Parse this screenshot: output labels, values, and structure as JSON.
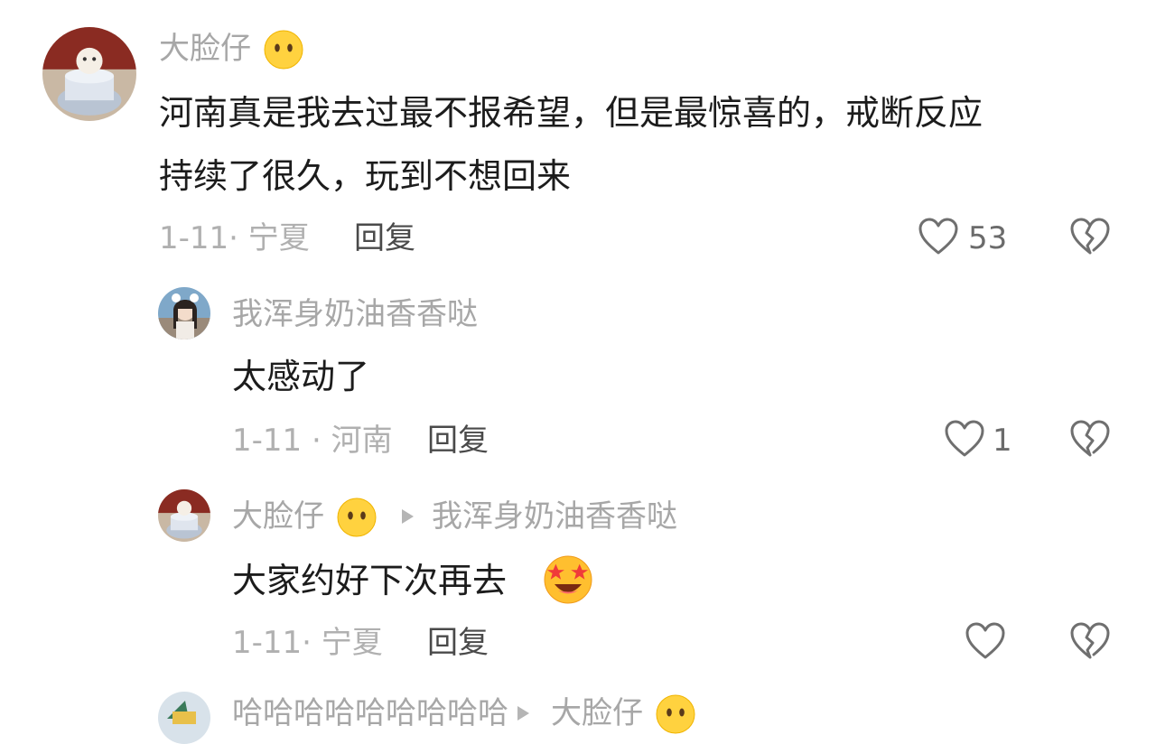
{
  "comments": [
    {
      "username": "大脸仔",
      "username_emoji": "neutral-face-emoji",
      "text_line1": "河南真是我去过最不报希望，但是最惊喜的，戒断反应",
      "text_line2": "持续了很久，玩到不想回来",
      "meta": "1-11· 宁夏",
      "reply_label": "回复",
      "likes": "53"
    },
    {
      "username": "我浑身奶油香香哒",
      "text": "太感动了",
      "meta": "1-11 · 河南",
      "reply_label": "回复",
      "likes": "1"
    },
    {
      "username": "大脸仔",
      "username_emoji": "neutral-face-emoji",
      "reply_to": "我浑身奶油香香哒",
      "text": "大家约好下次再去",
      "text_emoji": "star-struck-emoji",
      "meta": "1-11· 宁夏",
      "reply_label": "回复",
      "likes": ""
    },
    {
      "username": "哈哈哈哈哈哈哈哈哈",
      "reply_to": "大脸仔"
    }
  ],
  "icons": {
    "like": "heart-outline-icon",
    "dislike": "broken-heart-icon",
    "reply_arrow": "triangle-right-icon"
  },
  "colors": {
    "username": "#a7a7a7",
    "text": "#1c1c1c",
    "meta": "#b0b0b0",
    "icon": "#6f6f6f"
  }
}
